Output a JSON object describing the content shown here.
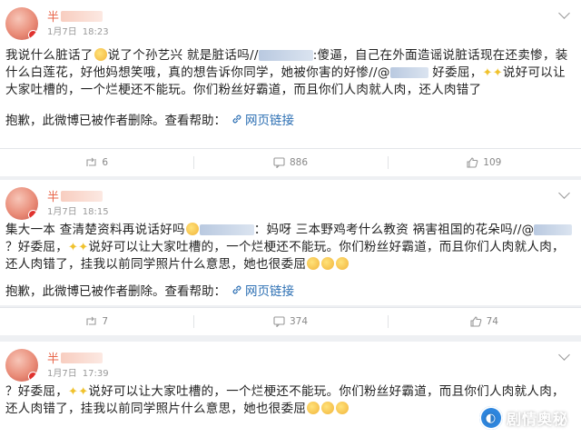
{
  "posts": [
    {
      "username_visible": "半",
      "date": "1月7日",
      "time": "18:23",
      "text_a": "我说什么脏话了",
      "text_b": "说了个孙艺兴 就是脏话吗//",
      "text_c": ":傻逼，自己在外面造谣说脏话现在还卖惨，装什么白莲花，好他妈想笑哦，真的想告诉你同学，她被你害的好惨//@",
      "text_d": "好委屈，",
      "text_e": "说好可以让大家吐槽的，一个烂梗还不能玩。你们粉丝好霸道，而且你们人肉就人肉，还人肉错了",
      "deleted_text": "抱歉，此微博已被作者删除。查看帮助：",
      "link_text": "网页链接",
      "reposts": "6",
      "comments": "886",
      "likes": "109"
    },
    {
      "username_visible": "半",
      "date": "1月7日",
      "time": "18:15",
      "text_a": "集大一本 查清楚资料再说话好吗",
      "text_b": "：妈呀 三本野鸡考什么教资  祸害祖国的花朵吗//@",
      "text_c": "？好委屈，",
      "text_d": "说好可以让大家吐槽的，一个烂梗还不能玩。你们粉丝好霸道，而且你们人肉就人肉，还人肉错了，挂我以前同学照片什么意思，她也很委屈",
      "deleted_text": "抱歉，此微博已被作者删除。查看帮助：",
      "link_text": "网页链接",
      "reposts": "7",
      "comments": "374",
      "likes": "74"
    },
    {
      "username_visible": "半",
      "date": "1月7日",
      "time": "17:39",
      "text_a": "？好委屈，",
      "text_b": "说好可以让大家吐槽的，一个烂梗还不能玩。你们粉丝好霸道，而且你们人肉就人肉，还人肉错了，挂我以前同学照片什么意思，她也很委屈"
    }
  ],
  "watermark": {
    "text": "剧情奥秘"
  },
  "icons": {
    "repost": "repost-icon",
    "comment": "comment-icon",
    "like": "like-icon",
    "link": "link-icon",
    "chevron": "chevron-down-icon"
  },
  "colors": {
    "username": "#e8664a",
    "link": "#2c6fb3",
    "background": "#eef0f3"
  }
}
